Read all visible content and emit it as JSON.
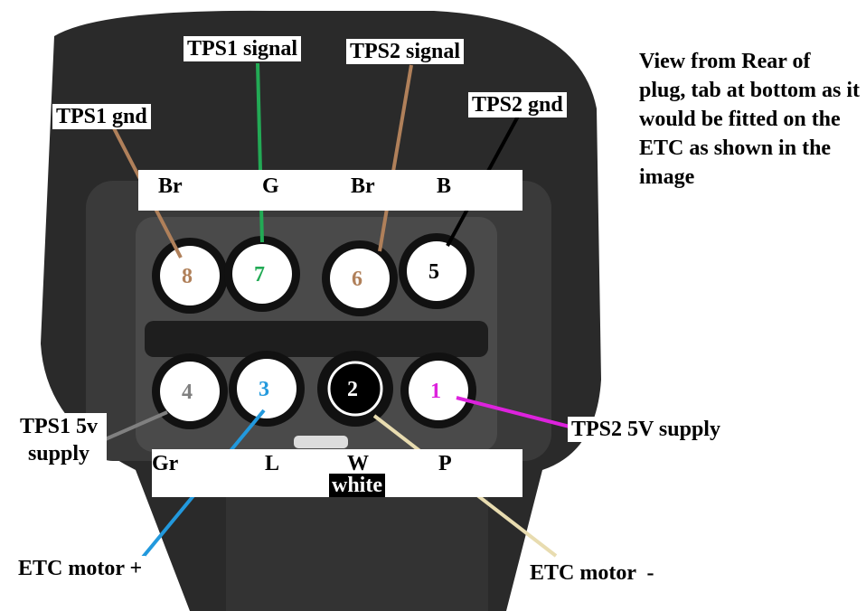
{
  "note": "View from Rear of plug, tab at bottom as it would be fitted on the ETC as shown in the image",
  "top_wire_colors": [
    "Br",
    "G",
    "Br",
    "B"
  ],
  "bottom_wire_colors": [
    "Gr",
    "L",
    "W",
    "P"
  ],
  "white_tag": "white",
  "pins": [
    {
      "number": "8",
      "label": "TPS1 gnd",
      "color": "#b0805a"
    },
    {
      "number": "7",
      "label": "TPS1 signal",
      "color": "#22aa55"
    },
    {
      "number": "6",
      "label": "TPS2 signal",
      "color": "#b0805a"
    },
    {
      "number": "5",
      "label": "TPS2 gnd",
      "color": "#000000"
    },
    {
      "number": "4",
      "label": "TPS1 5v supply",
      "color": "#808080"
    },
    {
      "number": "3",
      "label": "ETC motor +",
      "color": "#2299dd"
    },
    {
      "number": "2",
      "label": "ETC motor  -",
      "color": "#e8dcb0"
    },
    {
      "number": "1",
      "label": "TPS2 5V supply",
      "color": "#dd22dd"
    }
  ]
}
